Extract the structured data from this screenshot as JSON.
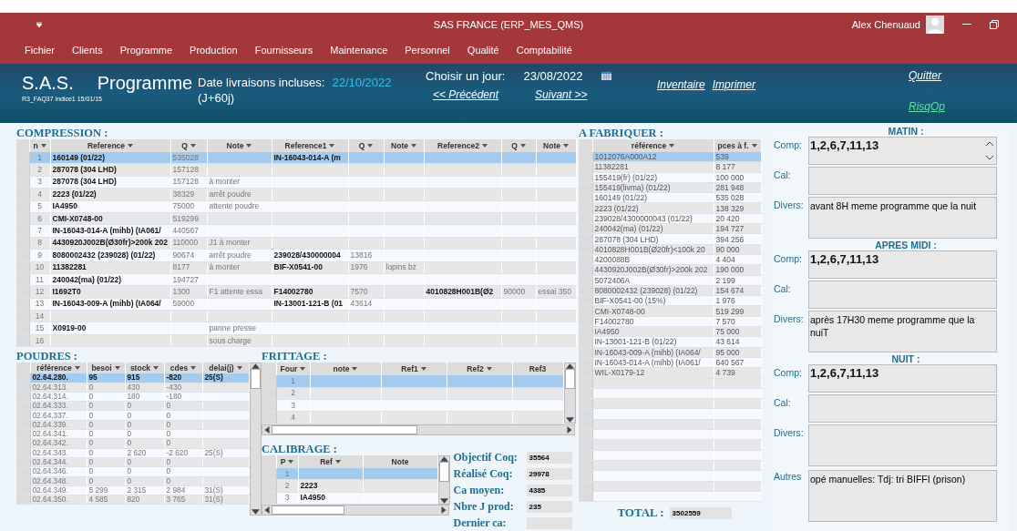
{
  "title_bar": {
    "title": "SAS FRANCE (ERP_MES_QMS)",
    "user": "Alex Chenuaud"
  },
  "menu": [
    "Fichier",
    "Clients",
    "Programme",
    "Production",
    "Fournisseurs",
    "Maintenance",
    "Personnel",
    "Qualité",
    "Comptabilité"
  ],
  "header": {
    "app_name": "S.A.S.",
    "program": "Programme",
    "version": "R3_FAQ37 indice1 15/01/15",
    "delivery_label": "Date livraisons incluses:",
    "delivery_date": "22/10/2022",
    "delivery_range": "(J+60j)",
    "day_label": "Choisir un jour:",
    "day_value": "23/08/2022",
    "previous": "<<  Précédent",
    "next": "Suivant >>",
    "links": [
      "Inventaire",
      "Imprimer"
    ],
    "quit": "Quitter",
    "risqop": "RisqOp"
  },
  "compression": {
    "title": "COMPRESSION :",
    "columns": [
      "n",
      "Reference",
      "Q",
      "Note",
      "Reference1",
      "Q",
      "Note",
      "Reference2",
      "Q",
      "Note"
    ],
    "rows": [
      {
        "n": "1",
        "reference": "160149 (01/22)",
        "q": "535028",
        "reference1": "IN-16043-014-A (m",
        "selected": true
      },
      {
        "n": "2",
        "reference": "287078 (304 LHD)",
        "q": "157128",
        "selected": false
      },
      {
        "n": "3",
        "reference": "287078 (304 LHD)",
        "q": "157128",
        "note": "à monter",
        "selected": false
      },
      {
        "n": "4",
        "reference": "2223 (01/22)",
        "q": "38329",
        "note": "arrêt poudre",
        "selected": false
      },
      {
        "n": "5",
        "reference": "IA4950",
        "q": "75000",
        "note": "attente poudre",
        "selected": false
      },
      {
        "n": "6",
        "reference": "CMI-X0748-00",
        "q": "519299",
        "selected": false
      },
      {
        "n": "7",
        "reference": "IN-16043-014-A (mihb) (IA061/",
        "q": "440567",
        "selected": false
      },
      {
        "n": "8",
        "reference": "4430920J002B(Ø30fr)>200k 202",
        "q": "110000",
        "note": "J1 à monter",
        "selected": false
      },
      {
        "n": "9",
        "reference": "8080002432 (239028) (01/22)",
        "q": "90674",
        "note": "arrêt poudre",
        "reference1": "239028/430000004",
        "q1": "13816",
        "selected": false
      },
      {
        "n": "10",
        "reference": "11382281",
        "q": "8177",
        "note": "à monter",
        "reference1": "BIF-X0541-00",
        "q1": "1976",
        "note1": "lopins bz",
        "selected": false
      },
      {
        "n": "11",
        "reference": "240042(ma) (01/22)",
        "q": "194727",
        "selected": false
      },
      {
        "n": "12",
        "reference": "I1692T0",
        "q": "1300",
        "note": "F1  attente essa",
        "reference1": "F14002780",
        "q1": "7570",
        "reference2": "4010828H001B(Ø2",
        "q2": "90000",
        "note2": "essai 350",
        "selected": false
      },
      {
        "n": "13",
        "reference": "IN-16043-009-A (mihb) (IA064/",
        "q": "59000",
        "reference1": "IN-13001-121-B (01",
        "q1": "43614",
        "selected": false
      },
      {
        "n": "14",
        "selected": false
      },
      {
        "n": "15",
        "reference": "X0919-00",
        "note": "panne presse",
        "selected": false
      },
      {
        "n": "16",
        "note": "sous charge",
        "selected": false
      }
    ]
  },
  "poudres": {
    "title": "POUDRES :",
    "columns": [
      "référence",
      "besoi",
      "stock",
      "cdes",
      "delai(j)"
    ],
    "rows": [
      {
        "reference": "02.64.280.",
        "besoin": "95",
        "stock": "915",
        "cdes": "-820",
        "delai": "25(S)",
        "selected": true
      },
      {
        "reference": "02.64.313.",
        "besoin": "0",
        "stock": "430",
        "cdes": "-430",
        "selected": false
      },
      {
        "reference": "02.64.314.",
        "besoin": "0",
        "stock": "180",
        "cdes": "-180",
        "selected": false
      },
      {
        "reference": "02.64.333.",
        "besoin": "0",
        "stock": "0",
        "cdes": "0",
        "selected": false
      },
      {
        "reference": "02.64.337.",
        "besoin": "0",
        "stock": "0",
        "cdes": "0",
        "selected": false
      },
      {
        "reference": "02.64.339.",
        "besoin": "0",
        "stock": "0",
        "cdes": "0",
        "selected": false
      },
      {
        "reference": "02.64.341.",
        "besoin": "0",
        "stock": "0",
        "cdes": "0",
        "selected": false
      },
      {
        "reference": "02.64.342.",
        "besoin": "0",
        "stock": "0",
        "cdes": "0",
        "selected": false
      },
      {
        "reference": "02.64.343.",
        "besoin": "0",
        "stock": "2 620",
        "cdes": "-2 620",
        "delai": "25(S)",
        "selected": false
      },
      {
        "reference": "02.64.344.",
        "besoin": "0",
        "stock": "0",
        "cdes": "0",
        "selected": false
      },
      {
        "reference": "02.64.346.",
        "besoin": "0",
        "stock": "0",
        "cdes": "0",
        "selected": false
      },
      {
        "reference": "02.64.348.",
        "besoin": "0",
        "stock": "0",
        "cdes": "0",
        "selected": false
      },
      {
        "reference": "02.64.349.",
        "besoin": "5 299",
        "stock": "2 315",
        "cdes": "2 984",
        "delai": "31(S)",
        "selected": false
      },
      {
        "reference": "02.64.350.",
        "besoin": "4 585",
        "stock": "820",
        "cdes": "3 765",
        "delai": "31(S)",
        "selected": false
      }
    ]
  },
  "frittage": {
    "title": "FRITTAGE :",
    "columns": [
      "Four",
      "note",
      "Ref1",
      "Ref2",
      "Ref3"
    ],
    "rows": [
      {
        "four": "1",
        "selected": true
      },
      {
        "four": "2",
        "selected": false
      },
      {
        "four": "3",
        "selected": false
      },
      {
        "four": "4",
        "selected": false
      }
    ]
  },
  "calibrage": {
    "title": "CALIBRAGE :",
    "columns": [
      "P",
      "Ref",
      "Note"
    ],
    "rows": [
      {
        "p": "1",
        "selected": true
      },
      {
        "p": "2",
        "ref": "2223",
        "selected": false
      },
      {
        "p": "3",
        "ref": "IA4950",
        "selected": false
      }
    ]
  },
  "stats": [
    {
      "label": "Objectif Coq:",
      "value": "35564"
    },
    {
      "label": "Réalisé Coq:",
      "value": "29978"
    },
    {
      "label": "Ca moyen:",
      "value": "4385"
    },
    {
      "label": "Nbre J prod:",
      "value": "235"
    },
    {
      "label": "Dernier ca:"
    }
  ],
  "a_fabriquer": {
    "title": "A FABRIQUER :",
    "columns": [
      "référence",
      "pces à f."
    ],
    "rows": [
      {
        "reference": "1012076A000A12",
        "pieces": "539",
        "selected": true
      },
      {
        "reference": "11382281",
        "pieces": "8 177",
        "selected": false
      },
      {
        "reference": "155419(fr) (01/22)",
        "pieces": "100 000",
        "selected": false
      },
      {
        "reference": "155419(livma) (01/22)",
        "pieces": "281 948",
        "selected": false
      },
      {
        "reference": "160149 (01/22)",
        "pieces": "535 028",
        "selected": false
      },
      {
        "reference": "2223 (01/22)",
        "pieces": "138 329",
        "selected": false
      },
      {
        "reference": "239028/4300000043 (01/22)",
        "pieces": "20 420",
        "selected": false
      },
      {
        "reference": "240042(ma) (01/22)",
        "pieces": "194 727",
        "selected": false
      },
      {
        "reference": "287078 (304 LHD)",
        "pieces": "394 256",
        "selected": false
      },
      {
        "reference": "4010828H001B(Ø20fr)<100k 20",
        "pieces": "90 000",
        "selected": false
      },
      {
        "reference": "4200088B",
        "pieces": "4 404",
        "selected": false
      },
      {
        "reference": "4430920J002B(Ø30fr)>200k 202",
        "pieces": "190 000",
        "selected": false
      },
      {
        "reference": "5072406A",
        "pieces": "2 199",
        "selected": false
      },
      {
        "reference": "8080002432 (239028) (01/22)",
        "pieces": "154 674",
        "selected": false
      },
      {
        "reference": "BIF-X0541-00 (15%)",
        "pieces": "1 976",
        "selected": false
      },
      {
        "reference": "CMI-X0748-00",
        "pieces": "519 299",
        "selected": false
      },
      {
        "reference": "F14002780",
        "pieces": "7 570",
        "selected": false
      },
      {
        "reference": "IA4950",
        "pieces": "75 000",
        "selected": false
      },
      {
        "reference": "IN-13001-121-B (01/22)",
        "pieces": "43 614",
        "selected": false
      },
      {
        "reference": "IN-16043-009-A (mihb) (IA064/",
        "pieces": "95 000",
        "selected": false
      },
      {
        "reference": "IN-16043-014-A (mihb) (IA061/",
        "pieces": "640 567",
        "selected": false
      },
      {
        "reference": "WIL-X0179-12",
        "pieces": "4 739",
        "selected": false
      }
    ],
    "total_label": "TOTAL :",
    "total_value": "3502559"
  },
  "shifts": [
    {
      "title": "MATIN :",
      "fields": [
        {
          "label": "Comp:",
          "kind": "comp",
          "value": "1,2,6,7,11,13",
          "scrollable": true
        },
        {
          "label": "Cal:",
          "kind": "cal",
          "scrollable": false
        },
        {
          "label": "Divers:",
          "kind": "divers",
          "value": "avant 8H meme programme que la nuit",
          "scrollable": false
        }
      ]
    },
    {
      "title": "APRES MIDI :",
      "fields": [
        {
          "label": "Comp:",
          "kind": "comp",
          "value": "1,2,6,7,11,13",
          "scrollable": false
        },
        {
          "label": "Cal:",
          "kind": "cal",
          "scrollable": false
        },
        {
          "label": "Divers:",
          "kind": "divers",
          "value": "après 17H30 meme programme que la nuiT",
          "scrollable": false
        }
      ]
    },
    {
      "title": "NUIT :",
      "fields": [
        {
          "label": "Comp:",
          "kind": "comp",
          "value": "1,2,6,7,11,13",
          "scrollable": false
        },
        {
          "label": "Cal:",
          "kind": "cal",
          "scrollable": false
        },
        {
          "label": "Divers:",
          "kind": "divers",
          "scrollable": false
        },
        {
          "label": "Autres",
          "kind": "autres",
          "value": "opé manuelles:  Tdj: tri BIFFI (prison)",
          "scrollable": false
        }
      ]
    }
  ]
}
